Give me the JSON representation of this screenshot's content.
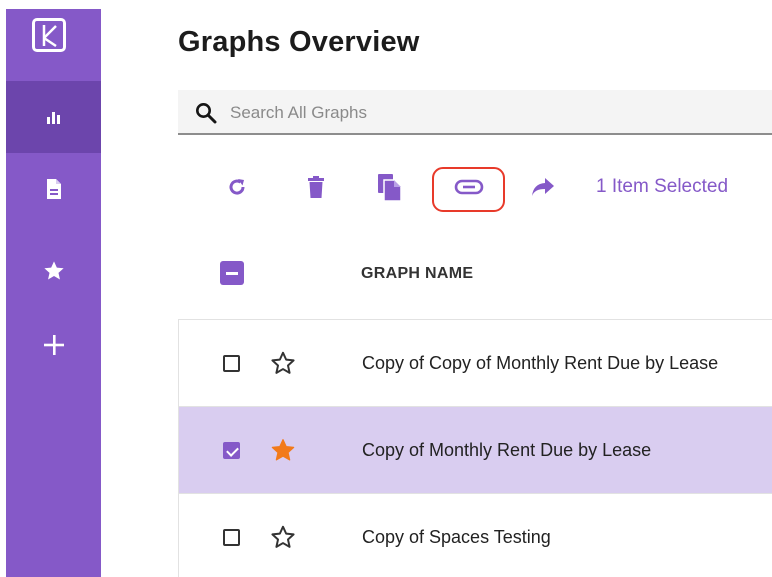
{
  "app": {
    "logo_icon": "kumu-logo-icon",
    "brand_color": "#8559c8",
    "active_color": "#6c45ac"
  },
  "sidebar": {
    "items": [
      {
        "icon": "bar-chart-icon",
        "active": true
      },
      {
        "icon": "document-icon",
        "active": false
      },
      {
        "icon": "star-icon",
        "active": false
      },
      {
        "icon": "plus-icon",
        "active": false
      }
    ]
  },
  "page": {
    "title": "Graphs Overview"
  },
  "search": {
    "placeholder": "Search All Graphs",
    "value": ""
  },
  "toolbar": {
    "buttons": [
      {
        "icon": "refresh-icon"
      },
      {
        "icon": "trash-icon"
      },
      {
        "icon": "copy-icon"
      },
      {
        "icon": "link-icon",
        "highlighted": true
      },
      {
        "icon": "share-arrow-icon"
      }
    ],
    "selection_text": "1 Item Selected",
    "highlight_color": "#e83a2a"
  },
  "table": {
    "column_header": "GRAPH NAME",
    "rows": [
      {
        "name": "Copy of Copy of Monthly Rent Due by Lease",
        "checked": false,
        "starred": false
      },
      {
        "name": "Copy of Monthly Rent Due by Lease",
        "checked": true,
        "starred": true
      },
      {
        "name": "Copy of Spaces Testing",
        "checked": false,
        "starred": false
      }
    ],
    "selected_row_color": "#d9cdf0",
    "starred_color": "#f27a1a"
  }
}
